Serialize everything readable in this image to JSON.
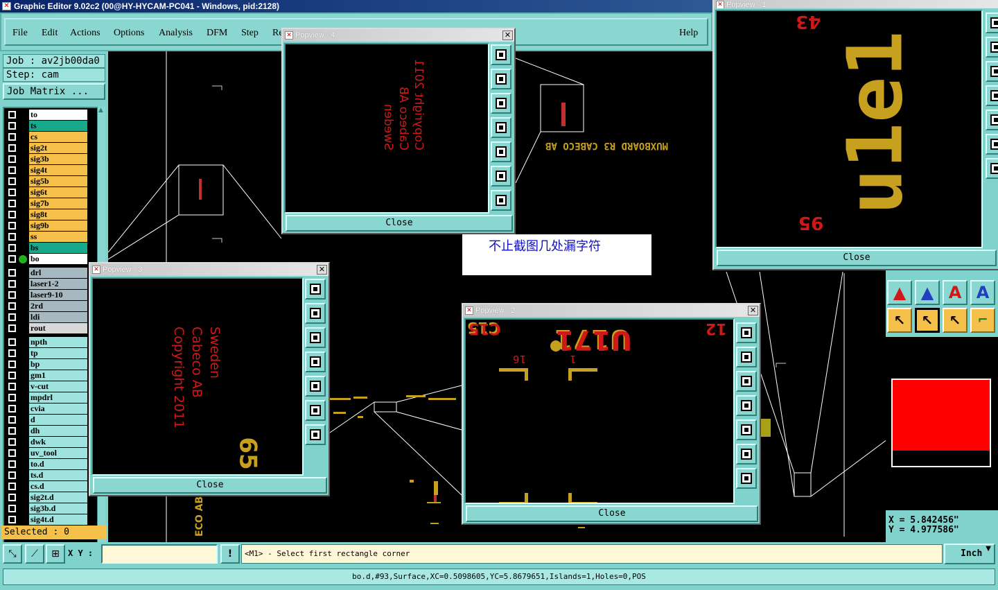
{
  "window": {
    "title": "Graphic Editor 9.02c2 (00@HY-HYCAM-PC041 - Windows, pid:2128)"
  },
  "menu": {
    "items": [
      "File",
      "Edit",
      "Actions",
      "Options",
      "Analysis",
      "DFM",
      "Step",
      "Re"
    ],
    "help": "Help"
  },
  "left": {
    "job": "Job : av2jb00da0",
    "step": "Step: cam",
    "job_matrix": "Job Matrix ...",
    "selected": "Selected : 0",
    "layers": [
      {
        "name": "to",
        "color": "#ffffff"
      },
      {
        "name": "ts",
        "color": "#18a88c"
      },
      {
        "name": "cs",
        "color": "#f5c04a"
      },
      {
        "name": "sig2t",
        "color": "#f5c04a"
      },
      {
        "name": "sig3b",
        "color": "#f5c04a"
      },
      {
        "name": "sig4t",
        "color": "#f5c04a"
      },
      {
        "name": "sig5b",
        "color": "#f5c04a"
      },
      {
        "name": "sig6t",
        "color": "#f5c04a"
      },
      {
        "name": "sig7b",
        "color": "#f5c04a"
      },
      {
        "name": "sig8t",
        "color": "#f5c04a"
      },
      {
        "name": "sig9b",
        "color": "#f5c04a"
      },
      {
        "name": "ss",
        "color": "#f5c04a"
      },
      {
        "name": "bs",
        "color": "#18a88c"
      },
      {
        "name": "bo",
        "color": "#ffffff"
      },
      {
        "name": "drl",
        "color": "#a8b8c0"
      },
      {
        "name": "laser1-2",
        "color": "#a8b8c0"
      },
      {
        "name": "laser9-10",
        "color": "#a8b8c0"
      },
      {
        "name": "2rd",
        "color": "#a8b8c0"
      },
      {
        "name": "ldi",
        "color": "#a8b8c0"
      },
      {
        "name": "rout",
        "color": "#d8d8d8"
      },
      {
        "name": "npth",
        "color": "#9ee3de"
      },
      {
        "name": "tp",
        "color": "#9ee3de"
      },
      {
        "name": "bp",
        "color": "#9ee3de"
      },
      {
        "name": "gm1",
        "color": "#9ee3de"
      },
      {
        "name": "v-cut",
        "color": "#9ee3de"
      },
      {
        "name": "mpdrl",
        "color": "#9ee3de"
      },
      {
        "name": "cvia",
        "color": "#9ee3de"
      },
      {
        "name": "d",
        "color": "#9ee3de"
      },
      {
        "name": "dh",
        "color": "#9ee3de"
      },
      {
        "name": "dwk",
        "color": "#9ee3de"
      },
      {
        "name": "uv_tool",
        "color": "#9ee3de"
      },
      {
        "name": "to.d",
        "color": "#9ee3de"
      },
      {
        "name": "ts.d",
        "color": "#9ee3de"
      },
      {
        "name": "cs.d",
        "color": "#9ee3de"
      },
      {
        "name": "sig2t.d",
        "color": "#9ee3de"
      },
      {
        "name": "sig3b.d",
        "color": "#9ee3de"
      },
      {
        "name": "sig4t.d",
        "color": "#9ee3de"
      }
    ]
  },
  "popviews": {
    "p1": {
      "title": "Popview - 1",
      "close": "Close",
      "text_big": "u1e1",
      "text_a": "43",
      "text_b": "95"
    },
    "p2": {
      "title": "Popview - 2",
      "close": "Close",
      "text_big": "U171",
      "text_a": "16",
      "text_b": "1",
      "text_c": "C15",
      "text_d": "12"
    },
    "p3": {
      "title": "Popview - 3",
      "close": "Close",
      "lines": [
        "Sweden",
        "Cabeco AB",
        "Copyright 2011"
      ],
      "text_b": "65"
    },
    "p4": {
      "title": "Popview - 4",
      "close": "Close",
      "lines": [
        "Sweden",
        "Cabeco AB",
        "Copyright 2011"
      ]
    }
  },
  "canvas": {
    "board_text": "MUXBOARD R3  CABECO AB",
    "bottom_text": "ECO AB"
  },
  "note": "不止截图几处漏字符",
  "coords": {
    "x": "X = 5.842456\"",
    "y": "Y = 4.977586\""
  },
  "bottom": {
    "xy_label": "X Y :",
    "xy_value": "",
    "bang": "!",
    "prompt": "<M1> - Select first rectangle corner",
    "units": "Inch"
  },
  "status": "bo.d,#93,Surface,XC=0.5098605,YC=5.8679651,Islands=1,Holes=0,POS"
}
